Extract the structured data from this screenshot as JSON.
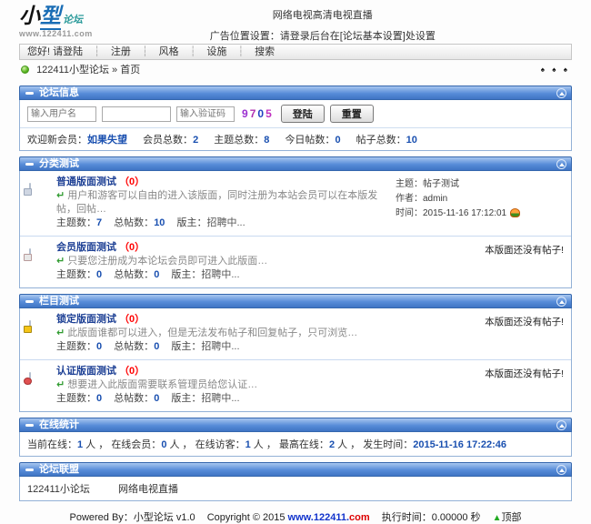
{
  "header": {
    "logo_char1": "小",
    "logo_char2": "型",
    "logo_sub": "论坛",
    "logo_url": "www.122411.com",
    "ad_line1": "网络电视高清电视直播",
    "ad_line2": "广告位置设置：请登录后台在[论坛基本设置]处设置"
  },
  "nav": {
    "greeting": "您好! 请登陆",
    "sep": "┆",
    "items": [
      "注册",
      "风格",
      "设施",
      "搜索"
    ]
  },
  "breadcrumb": {
    "site": "122411小型论坛",
    "arrow": "»",
    "page": "首页",
    "corner_glyphs": "♠ ♠ ♠"
  },
  "forum_info": {
    "title": "论坛信息",
    "login": {
      "username_placeholder": "输入用户名",
      "captcha_placeholder": "输入验证码",
      "captcha_digits": [
        "9",
        "7",
        "0",
        "5"
      ],
      "login_label": "登陆",
      "reset_label": "重置"
    },
    "stats": [
      {
        "label": "欢迎新会员：",
        "value": "如果失望"
      },
      {
        "label": "会员总数：",
        "value": "2"
      },
      {
        "label": "主题总数：",
        "value": "8"
      },
      {
        "label": "今日帖数：",
        "value": "0"
      },
      {
        "label": "帖子总数：",
        "value": "10"
      }
    ]
  },
  "sections": [
    {
      "title": "分类测试",
      "forums": [
        {
          "name": "普通版面测试",
          "count": "（0）",
          "reply_glyph": "↵",
          "desc": "用户和游客可以自由的进入该版面，同时注册为本站会员可以在本版发帖，回帖…",
          "topics_label": "主题数：",
          "topics": "7",
          "posts_label": "总帖数：",
          "posts": "10",
          "mod_label": "版主：",
          "mod": "招聘中...",
          "last_topic_label": "主题：",
          "last_topic": "帖子测试",
          "last_author_label": "作者：",
          "last_author": "admin",
          "last_time_label": "时间：",
          "last_time": "2015-11-16 17:12:01"
        },
        {
          "name": "会员版面测试",
          "count": "（0）",
          "reply_glyph": "↵",
          "desc": "只要您注册成为本论坛会员即可进入此版面…",
          "topics_label": "主题数：",
          "topics": "0",
          "posts_label": "总帖数：",
          "posts": "0",
          "mod_label": "版主：",
          "mod": "招聘中...",
          "empty_text": "本版面还没有帖子!"
        }
      ]
    },
    {
      "title": "栏目测试",
      "forums": [
        {
          "name": "锁定版面测试",
          "count": "（0）",
          "reply_glyph": "↵",
          "desc": "此版面谁都可以进入，但是无法发布帖子和回复帖子，只可浏览…",
          "topics_label": "主题数：",
          "topics": "0",
          "posts_label": "总帖数：",
          "posts": "0",
          "mod_label": "版主：",
          "mod": "招聘中...",
          "empty_text": "本版面还没有帖子!"
        },
        {
          "name": "认证版面测试",
          "count": "（0）",
          "reply_glyph": "↵",
          "desc": "想要进入此版面需要联系管理员给您认证…",
          "topics_label": "主题数：",
          "topics": "0",
          "posts_label": "总帖数：",
          "posts": "0",
          "mod_label": "版主：",
          "mod": "招聘中...",
          "empty_text": "本版面还没有帖子!"
        }
      ]
    }
  ],
  "online": {
    "title": "在线统计",
    "segments": [
      {
        "label": "当前在线：",
        "num": "1",
        "suffix": " 人 ，"
      },
      {
        "label": "在线会员：",
        "num": "0",
        "suffix": " 人 ，"
      },
      {
        "label": "在线访客：",
        "num": "1",
        "suffix": " 人 ，"
      },
      {
        "label": "最高在线：",
        "num": "2",
        "suffix": " 人 ，"
      },
      {
        "label": "发生时间：",
        "num": "2015-11-16 17:22:46",
        "suffix": ""
      }
    ]
  },
  "alliance": {
    "title": "论坛联盟",
    "links": [
      "122411小论坛",
      "网络电视直播"
    ]
  },
  "footer": {
    "powered_label": "Powered By：",
    "app": "小型论坛 v1.0",
    "copyright": "Copyright © 2015",
    "url_main": "www.122411.",
    "url_tld": "com",
    "exec_text": "执行时间：0.00000 秒",
    "top_arrow_glyph": "▲",
    "top_label": "顶部"
  },
  "colors": {
    "bar_blue": "#4a7fd0",
    "link_blue": "#1a50b0",
    "count_red": "#ff0000",
    "panel_border": "#93b1d6"
  }
}
